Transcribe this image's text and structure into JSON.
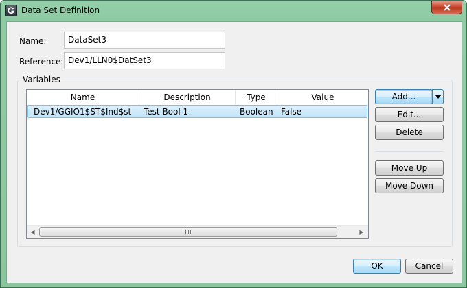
{
  "window": {
    "title": "Data Set Definition"
  },
  "form": {
    "name_label": "Name:",
    "name_value": "DataSet3",
    "reference_label": "Reference:",
    "reference_value": "Dev1/LLN0$DatSet3"
  },
  "variables": {
    "group_title": "Variables",
    "columns": [
      "Name",
      "Description",
      "Type",
      "Value"
    ],
    "rows": [
      {
        "name": "Dev1/GGIO1$ST$Ind$st",
        "description": "Test Bool 1",
        "type": "Boolean",
        "value": "False"
      }
    ]
  },
  "buttons": {
    "add": "Add...",
    "edit": "Edit...",
    "delete": "Delete",
    "move_up": "Move Up",
    "move_down": "Move Down",
    "ok": "OK",
    "cancel": "Cancel"
  },
  "icons": {
    "app": "app-logo-icon",
    "close": "close-icon",
    "dropdown": "chevron-down-icon",
    "scroll_left": "arrow-left-icon",
    "scroll_right": "arrow-right-icon"
  }
}
